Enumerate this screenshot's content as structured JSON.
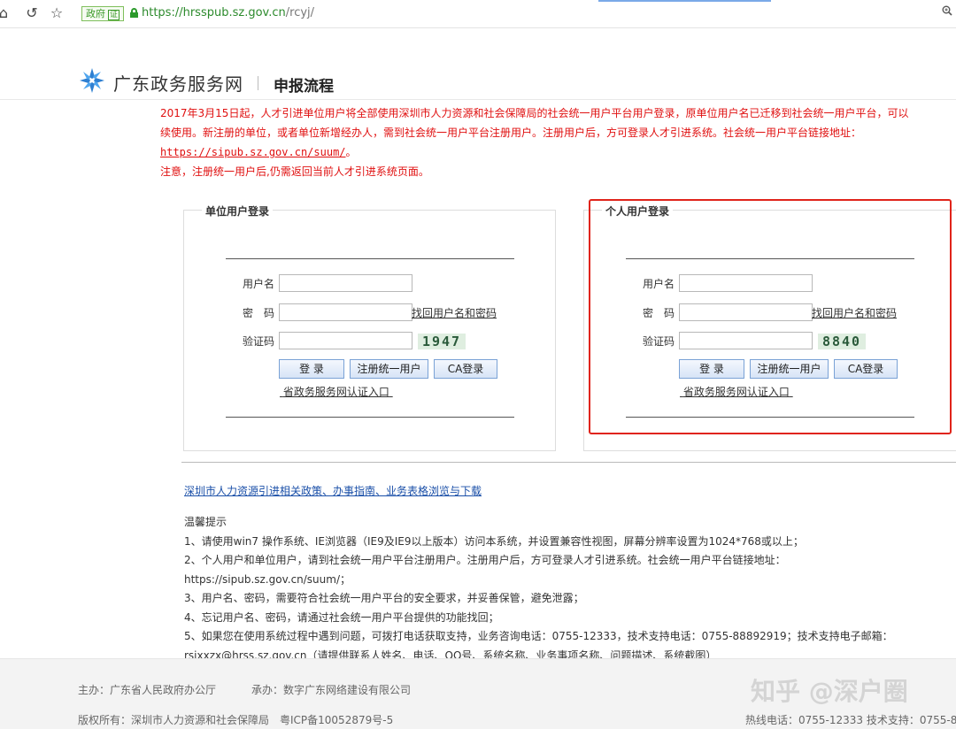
{
  "browser": {
    "gov_badge": "政府",
    "gov_badge_mark": "证",
    "url_host": "https://hrsspub.sz.gov.cn",
    "url_path": "/rcyj/"
  },
  "header": {
    "site_name": "广东政务服务网",
    "page_title": "申报流程"
  },
  "notice": {
    "line1": "2017年3月15日起，人才引进单位用户将全部使用深圳市人力资源和社会保障局的社会统一用户平台用户登录，原单位用户名已迁移到社会统一用户平台，可以",
    "line2": "续使用。新注册的单位，或者单位新增经办人，需到社会统一用户平台注册用户。注册用户后，方可登录人才引进系统。社会统一用户平台链接地址：",
    "link": "https://sipub.sz.gov.cn/suum/",
    "link_suffix": "。",
    "line4": "注意，注册统一用户后,仍需返回当前人才引进系统页面。"
  },
  "unit_login": {
    "title": "单位用户登录",
    "username_label": "用户名",
    "password_label": "密　码",
    "captcha_label": "验证码",
    "forgot_link": "找回用户名和密码",
    "captcha_code": "1947",
    "login_button": "登 录",
    "register_button": "注册统一用户",
    "ca_button": "CA登录",
    "portal_link": "省政务服务网认证入口"
  },
  "personal_login": {
    "title": "个人用户登录",
    "username_label": "用户名",
    "password_label": "密　码",
    "captcha_label": "验证码",
    "forgot_link": "找回用户名和密码",
    "captcha_code": "8840",
    "login_button": "登 录",
    "register_button": "注册统一用户",
    "ca_button": "CA登录",
    "portal_link": "省政务服务网认证入口"
  },
  "policy_link": "深圳市人力资源引进相关政策、办事指南、业务表格浏览与下载",
  "tips": {
    "title": "温馨提示",
    "items": [
      "1、请使用win7 操作系统、IE浏览器（IE9及IE9以上版本）访问本系统，并设置兼容性视图，屏幕分辨率设置为1024*768或以上；",
      "2、个人用户和单位用户，请到社会统一用户平台注册用户。注册用户后，方可登录人才引进系统。社会统一用户平台链接地址：",
      "https://sipub.sz.gov.cn/suum/；",
      "3、用户名、密码，需要符合社会统一用户平台的安全要求，并妥善保管，避免泄露；",
      "4、忘记用户名、密码，请通过社会统一用户平台提供的功能找回；",
      "5、如果您在使用系统过程中遇到问题，可拨打电话获取支持，业务咨询电话：0755-12333，技术支持电话：0755-88892919；技术支持电子邮箱：",
      "rsjxxzx@hrss.sz.gov.cn（请提供联系人姓名、电话、QQ号、系统名称、业务事项名称、问题描述、系统截图）"
    ]
  },
  "footer": {
    "sponsor": "主办：广东省人民政府办公厅",
    "organizer": "承办：数字广东网络建设有限公司",
    "copyright": "版权所有：深圳市人力资源和社会保障局　粤ICP备10052879号-5",
    "hotline": "热线电话：0755-12333 技术支持：0755-8",
    "watermark": "知乎 @深户圈"
  },
  "colors": {
    "notice_red": "#e01010",
    "highlight_box": "#e0241a",
    "link_blue": "#1a4fa8",
    "url_green": "#2c8a2c"
  }
}
